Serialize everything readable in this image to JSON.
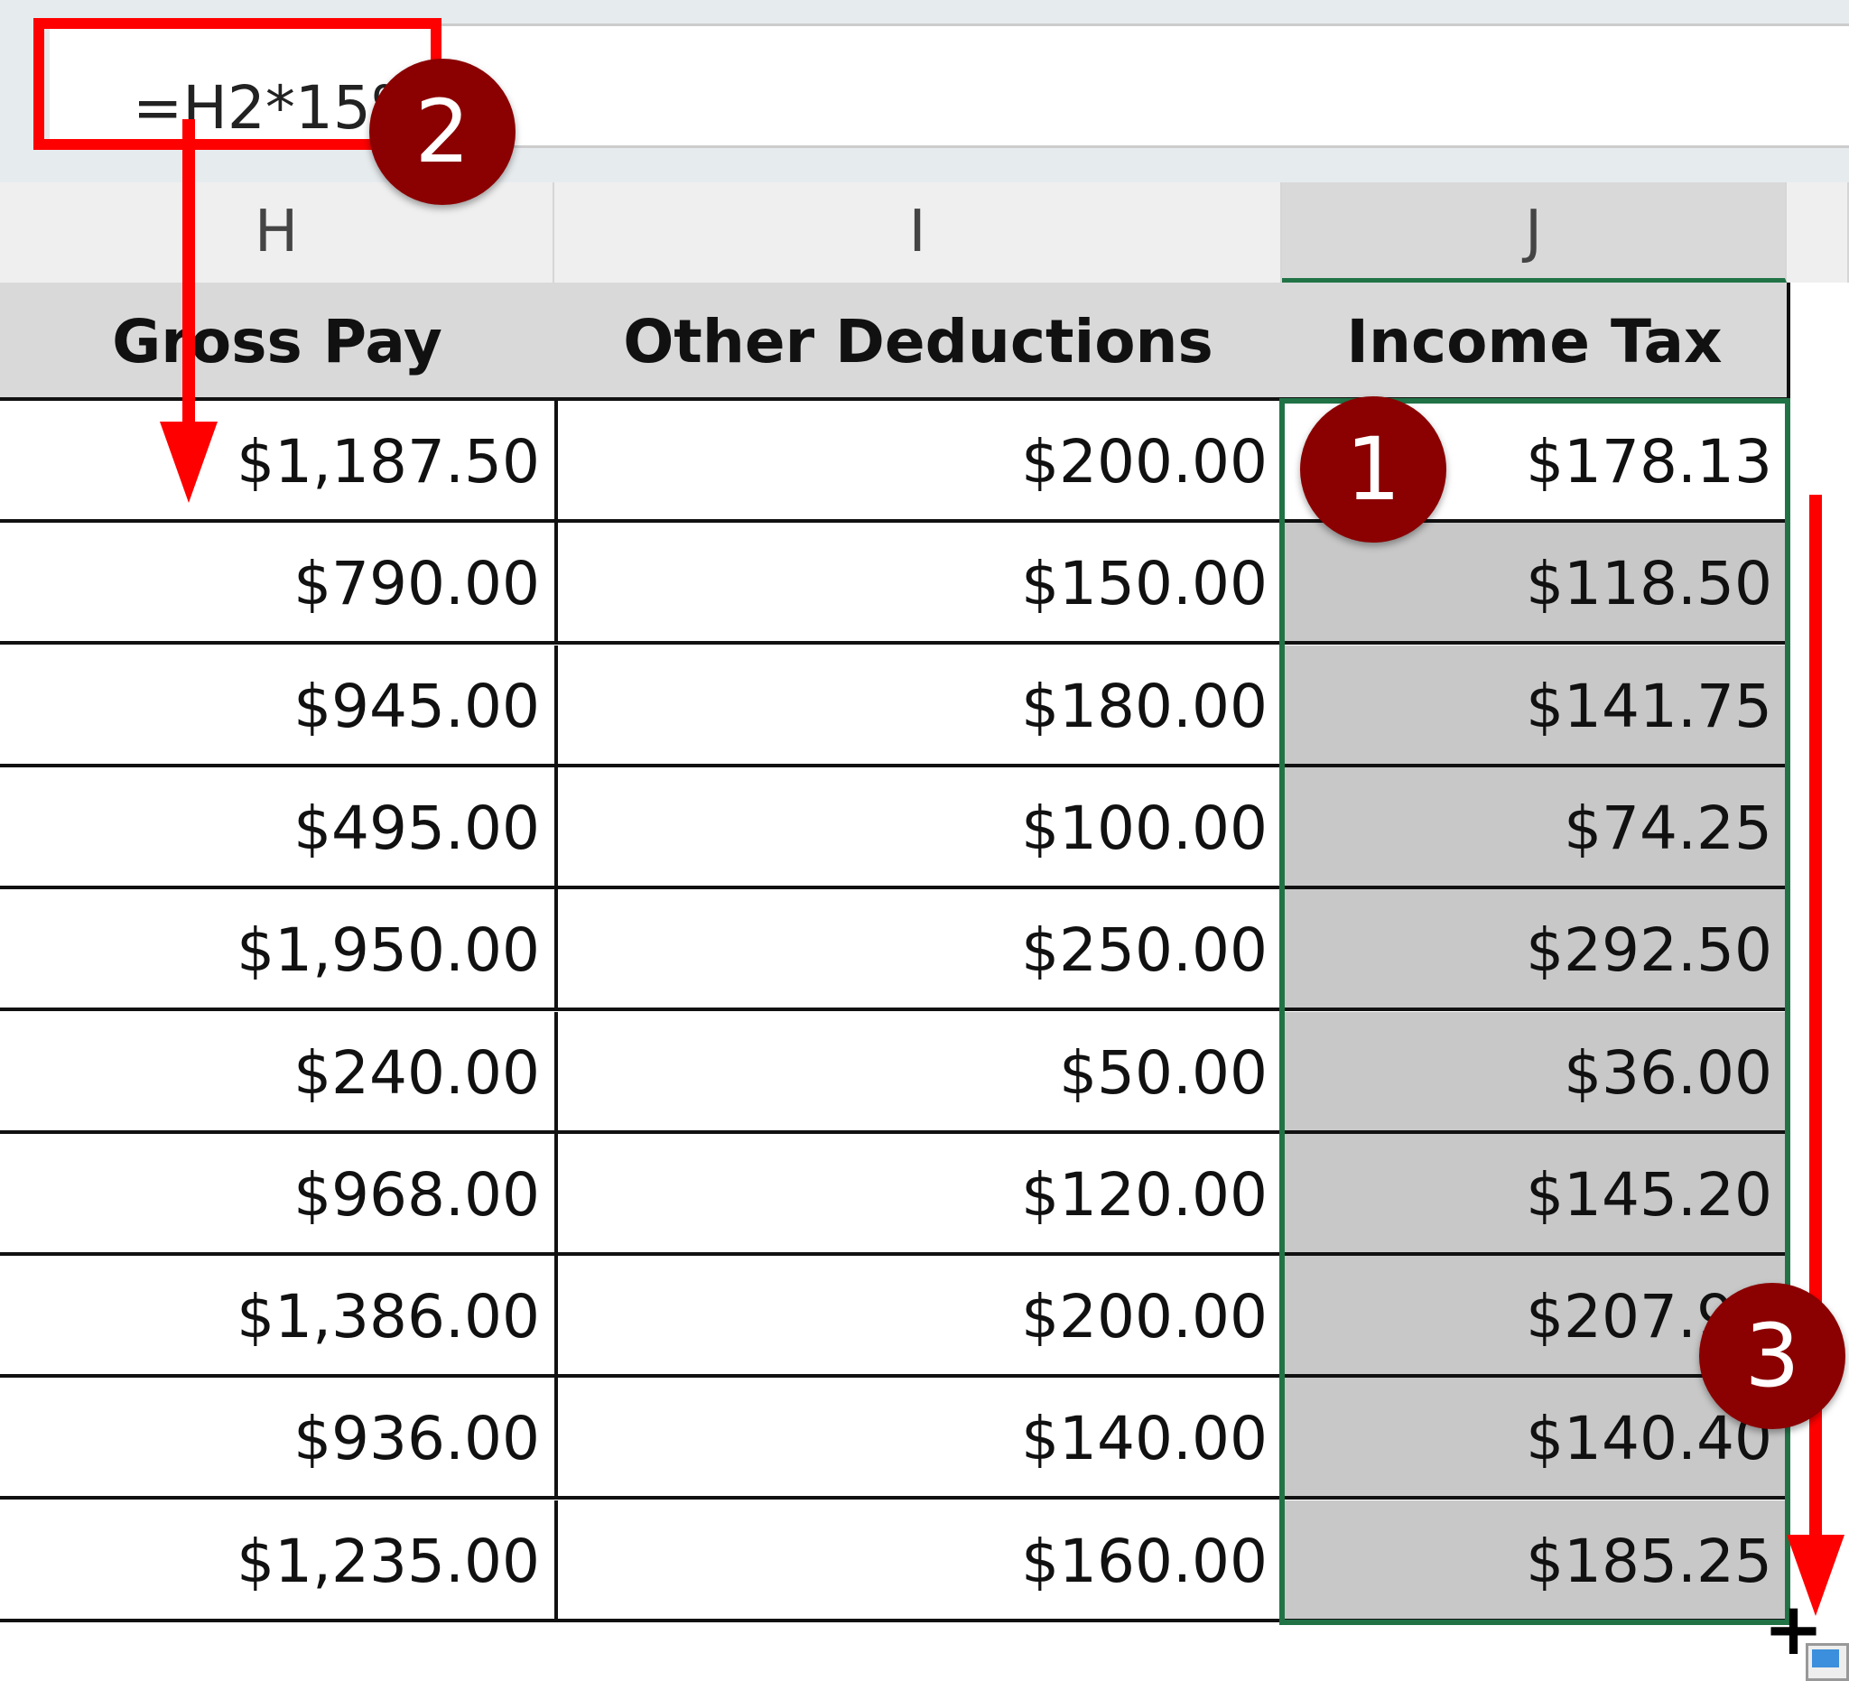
{
  "formula_bar": {
    "value": "=H2*15%"
  },
  "columns": [
    {
      "letter": "H",
      "header": "Gross Pay"
    },
    {
      "letter": "I",
      "header": "Other Deductions"
    },
    {
      "letter": "J",
      "header": "Income Tax"
    }
  ],
  "rows": [
    [
      "$1,187.50",
      "$200.00",
      "$178.13"
    ],
    [
      "$790.00",
      "$150.00",
      "$118.50"
    ],
    [
      "$945.00",
      "$180.00",
      "$141.75"
    ],
    [
      "$495.00",
      "$100.00",
      "$74.25"
    ],
    [
      "$1,950.00",
      "$250.00",
      "$292.50"
    ],
    [
      "$240.00",
      "$50.00",
      "$36.00"
    ],
    [
      "$968.00",
      "$120.00",
      "$145.20"
    ],
    [
      "$1,386.00",
      "$200.00",
      "$207.90"
    ],
    [
      "$936.00",
      "$140.00",
      "$140.40"
    ],
    [
      "$1,235.00",
      "$160.00",
      "$185.25"
    ]
  ],
  "annotations": {
    "step1": "1",
    "step2": "2",
    "step3": "3"
  },
  "colors": {
    "annotation_red": "#ff0000",
    "badge": "#8b0000",
    "selection": "#217346",
    "selected_fill": "#c8c8c8"
  }
}
